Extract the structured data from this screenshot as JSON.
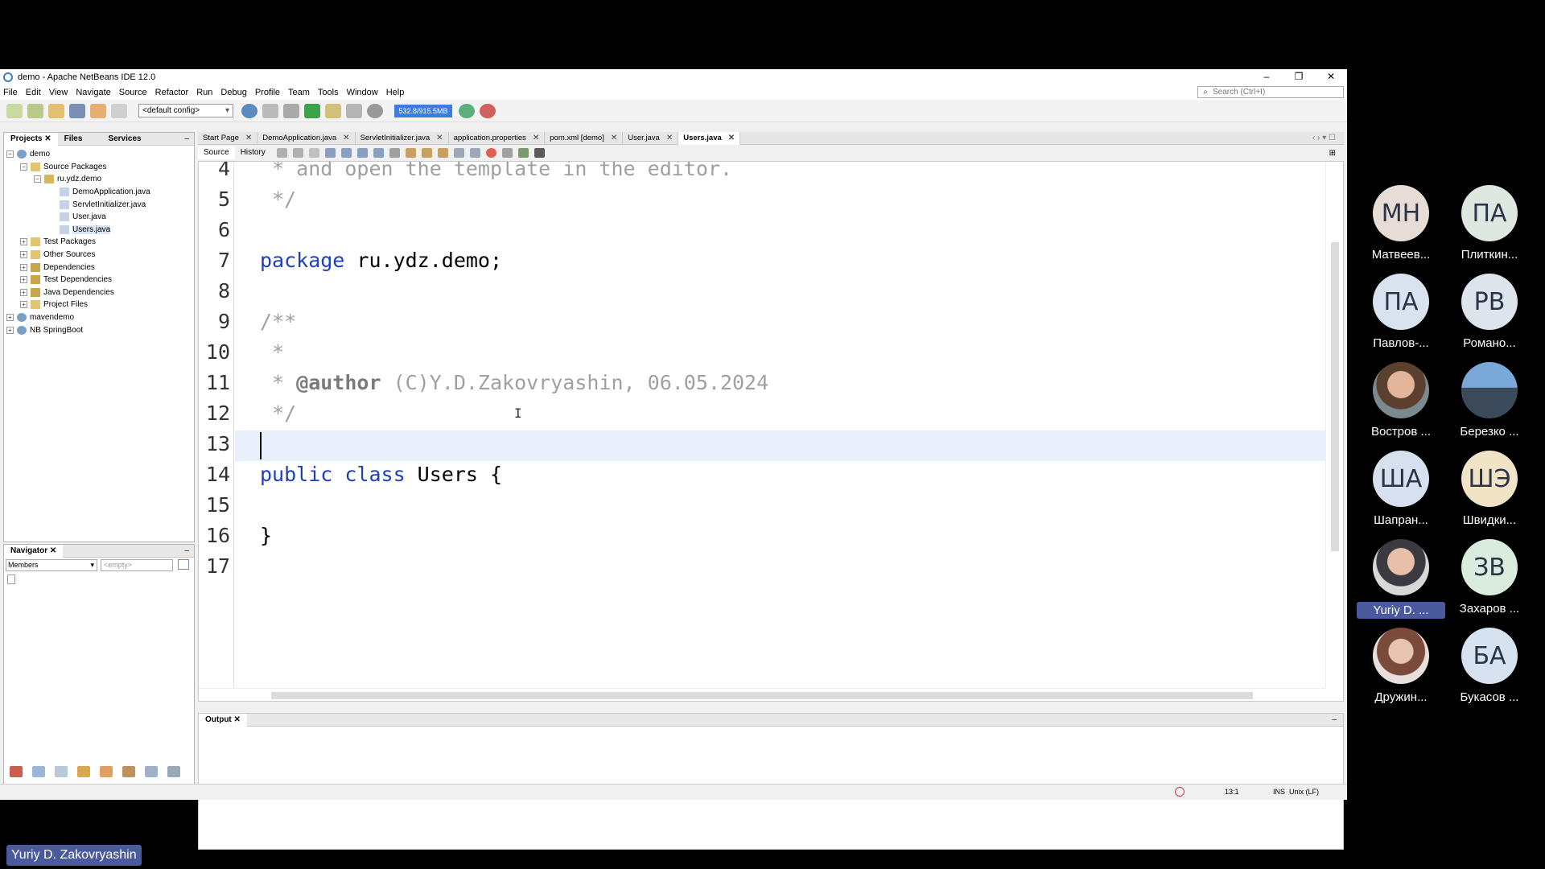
{
  "window": {
    "title": "demo - Apache NetBeans IDE 12.0"
  },
  "menu": [
    "File",
    "Edit",
    "View",
    "Navigate",
    "Source",
    "Refactor",
    "Run",
    "Debug",
    "Profile",
    "Team",
    "Tools",
    "Window",
    "Help"
  ],
  "search": {
    "placeholder": "Search (Ctrl+I)"
  },
  "toolbar": {
    "config": "<default config>",
    "memory": "532.8/915.5MB"
  },
  "projects_panel": {
    "tabs": [
      "Projects",
      "Files",
      "Services"
    ],
    "tree": [
      {
        "label": "demo"
      },
      {
        "label": "Source Packages"
      },
      {
        "label": "ru.ydz.demo"
      },
      {
        "label": "DemoApplication.java"
      },
      {
        "label": "ServletInitializer.java"
      },
      {
        "label": "User.java"
      },
      {
        "label": "Users.java"
      },
      {
        "label": "Test Packages"
      },
      {
        "label": "Other Sources"
      },
      {
        "label": "Dependencies"
      },
      {
        "label": "Test Dependencies"
      },
      {
        "label": "Java Dependencies"
      },
      {
        "label": "Project Files"
      },
      {
        "label": "mavendemo"
      },
      {
        "label": "NB SpringBoot"
      }
    ]
  },
  "navigator": {
    "title": "Navigator",
    "filter": "Members",
    "empty": "<empty>"
  },
  "editor": {
    "tabs": [
      "Start Page",
      "DemoApplication.java",
      "ServletInitializer.java",
      "application.properties",
      "pom.xml [demo]",
      "User.java",
      "Users.java"
    ],
    "subtabs": [
      "Source",
      "History"
    ],
    "line_numbers": [
      "4",
      "5",
      "6",
      "7",
      "8",
      "9",
      "10",
      "11",
      "12",
      "13",
      "14",
      "15",
      "16",
      "17"
    ],
    "code": {
      "l4": " * and open the template in the editor.",
      "l5": " */",
      "l7_kw": "package",
      "l7_rest": " ru.ydz.demo;",
      "l9": "/**",
      "l10": " *",
      "l11_star": " * ",
      "l11_tag": "@author",
      "l11_rest": " (C)Y.D.Zakovryashin, 06.05.2024",
      "l12": " */",
      "l14_kw": "public class",
      "l14_rest": " Users {",
      "l16": "}"
    }
  },
  "output": {
    "title": "Output"
  },
  "status": {
    "position": "13:1",
    "mode": "INS",
    "line_ending": "Unix (LF)"
  },
  "participants": [
    {
      "initials": "МН",
      "name": "Матвеев...",
      "color": "#e7dcd6"
    },
    {
      "initials": "ПА",
      "name": "Плиткин...",
      "color": "#dfe8e0"
    },
    {
      "initials": "ПА",
      "name": "Павлов-...",
      "color": "#d9e3ef"
    },
    {
      "initials": "РВ",
      "name": "Романо...",
      "color": "#dde4ec"
    },
    {
      "initials": "",
      "name": "Востров ...",
      "color": "#8a6a50"
    },
    {
      "initials": "",
      "name": "Березко ...",
      "color": "#6a8aa8"
    },
    {
      "initials": "ША",
      "name": "Шапран...",
      "color": "#d6e0ee"
    },
    {
      "initials": "ШЭ",
      "name": "Швидки...",
      "color": "#f0e3c6"
    },
    {
      "initials": "",
      "name": "Yuriy D. ...",
      "color": "#c9c9c9"
    },
    {
      "initials": "ЗВ",
      "name": "Захаров ...",
      "color": "#d9ecdd"
    },
    {
      "initials": "",
      "name": "Дружин...",
      "color": "#b49a92"
    },
    {
      "initials": "БА",
      "name": "Букасов ...",
      "color": "#d6e2ef"
    }
  ],
  "speaker": "Yuriy D. Zakovryashin"
}
